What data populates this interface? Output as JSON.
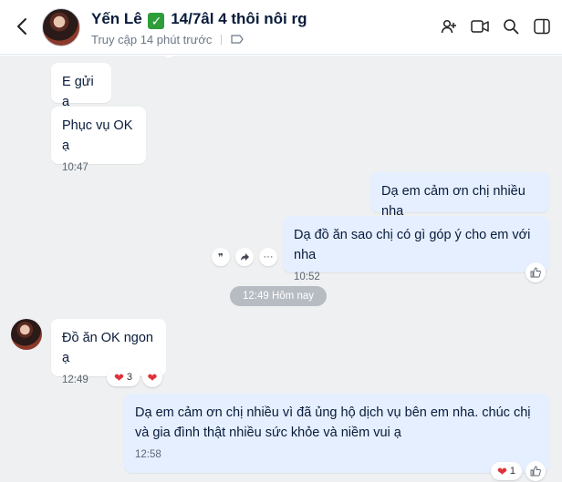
{
  "header": {
    "contact_name": "Yến Lê",
    "check_emoji": "✓",
    "name_suffix": "14/7âl 4 thôi nôi rg",
    "status": "Truy cập 14 phút trước",
    "icons": [
      "back-arrow-icon",
      "add-member-icon",
      "video-call-icon",
      "search-icon",
      "panel-toggle-icon",
      "tag-icon"
    ]
  },
  "messages": {
    "m1": {
      "text": "E gửi a"
    },
    "m2": {
      "text": "Phục vụ OK ạ",
      "time": "10:47"
    },
    "m3": {
      "text": "Dạ em cảm ơn chị nhiều nha"
    },
    "m4": {
      "text": "Dạ đồ ăn sao chị có gì góp ý cho em với nha",
      "time": "10:52"
    },
    "date_divider": "12:49 Hôm nay",
    "m5": {
      "text": "Đồ ăn OK ngon ạ",
      "time": "12:49",
      "reaction_count": "3"
    },
    "m6": {
      "text": "Dạ em cảm ơn chị nhiều vì đã ủng hộ dịch vụ bên em nha. chúc chị và gia đình thật nhiều sức khỏe và niềm vui ạ",
      "time": "12:58",
      "reaction_count": "1"
    }
  },
  "colors": {
    "incoming_bg": "#ffffff",
    "outgoing_bg": "#e5efff",
    "chat_bg": "#eef0f1",
    "heart": "#e0323b"
  }
}
